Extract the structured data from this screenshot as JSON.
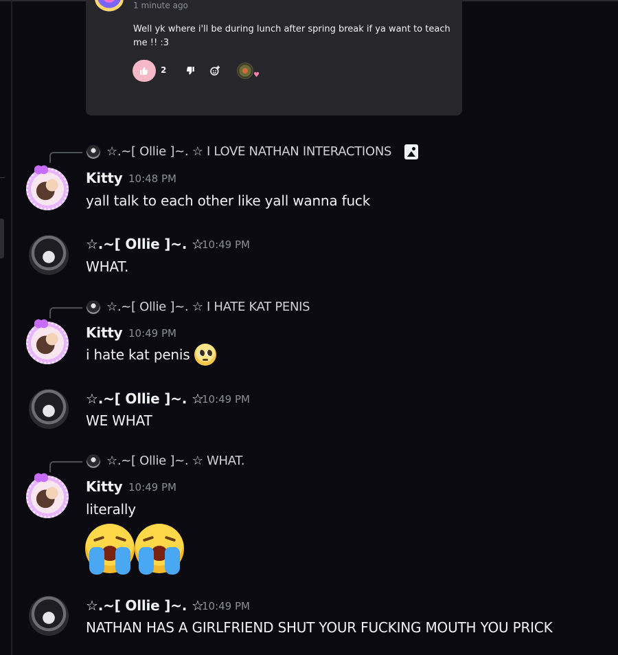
{
  "embed": {
    "time": "1 minute ago",
    "text": "Well yk where i'll be during lunch after spring break if ya want to teach me !! :3",
    "like_count": "2"
  },
  "messages": [
    {
      "reply": {
        "author": "☆.~[ Ollie ]~. ☆",
        "text": "I LOVE NATHAN INTERACTIONS"
      },
      "author": "Kitty",
      "time": "10:48 PM",
      "text": "yall talk to each other like yall wanna fuck"
    },
    {
      "author": "☆.~[ Ollie ]~. ☆",
      "time": "10:49 PM",
      "text": "WHAT."
    },
    {
      "reply": {
        "author": "☆.~[ Ollie ]~. ☆",
        "text": "I HATE KAT PENIS"
      },
      "author": "Kitty",
      "time": "10:49 PM",
      "text": "i hate kat penis"
    },
    {
      "author": "☆.~[ Ollie ]~. ☆",
      "time": "10:49 PM",
      "text": "WE WHAT"
    },
    {
      "reply": {
        "author": "☆.~[ Ollie ]~. ☆",
        "text": "WHAT."
      },
      "author": "Kitty",
      "time": "10:49 PM",
      "text": "literally"
    },
    {
      "author": "☆.~[ Ollie ]~. ☆",
      "time": "10:49 PM",
      "text": "NATHAN HAS A GIRLFRIEND SHUT YOUR FUCKING MOUTH YOU PRICK"
    }
  ],
  "icons": {
    "like": "thumbs-up-icon",
    "dislike": "thumbs-down-icon",
    "add_reaction": "add-reaction-icon",
    "reply_attachment": "image-icon",
    "emoji_pleading": "pleading-face-emoji",
    "emoji_sob": "loudly-crying-face-emoji"
  },
  "colors": {
    "background": "#0b0a10",
    "card": "#27272b",
    "like_button": "#f5b8c8"
  }
}
